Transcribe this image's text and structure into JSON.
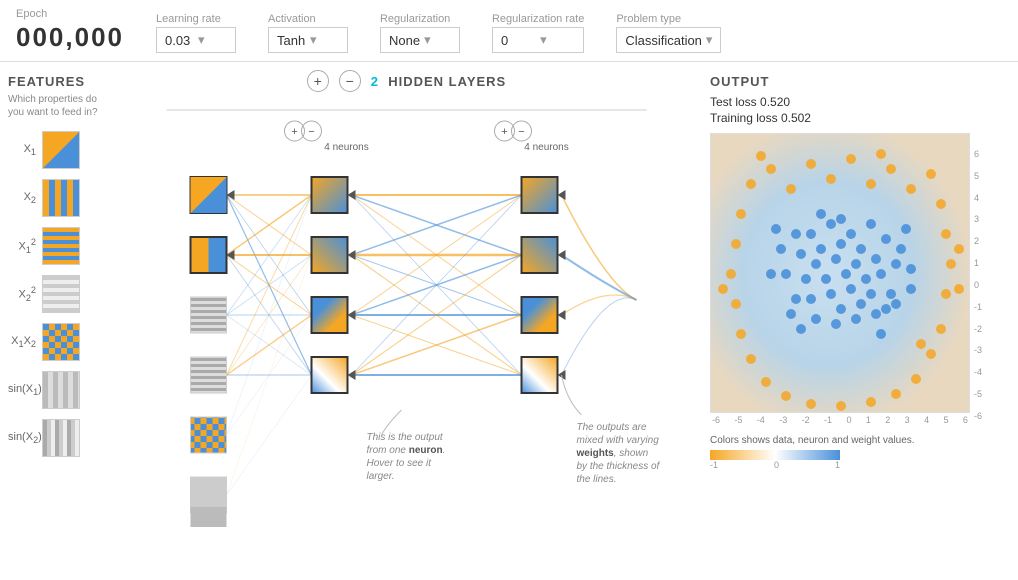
{
  "header": {
    "epoch_label": "Epoch",
    "epoch_value": "000,000",
    "learning_rate_label": "Learning rate",
    "learning_rate_value": "0.03",
    "activation_label": "Activation",
    "activation_value": "Tanh",
    "regularization_label": "Regularization",
    "regularization_value": "None",
    "regularization_rate_label": "Regularization rate",
    "regularization_rate_value": "0",
    "problem_type_label": "Problem type",
    "problem_type_value": "Classification"
  },
  "features": {
    "title": "FEATURES",
    "subtitle": "Which properties do you want to feed in?",
    "items": [
      {
        "label": "X₁",
        "style": "orange-blue"
      },
      {
        "label": "X₂",
        "style": "stripe-v"
      },
      {
        "label": "X₁²",
        "style": "stripe-h"
      },
      {
        "label": "X₂²",
        "style": "stripe-h2"
      },
      {
        "label": "X₁X₂",
        "style": "checker"
      },
      {
        "label": "sin(X₁)",
        "style": "sin1"
      },
      {
        "label": "sin(X₂)",
        "style": "sin2"
      }
    ]
  },
  "network": {
    "plus_label": "+",
    "minus_label": "−",
    "hidden_layers_count": "2",
    "hidden_layers_label": "HIDDEN LAYERS",
    "layer1_neurons_label": "4 neurons",
    "layer2_neurons_label": "4 neurons",
    "annotation1": "This is the output from one neuron. Hover to see it larger.",
    "annotation2": "The outputs are mixed with varying weights, shown by the thickness of the lines."
  },
  "output": {
    "title": "OUTPUT",
    "test_loss_label": "Test loss",
    "test_loss_value": "0.520",
    "training_loss_label": "Training loss",
    "training_loss_value": "0.502",
    "y_axis_values": [
      "6",
      "5",
      "4",
      "3",
      "2",
      "1",
      "0",
      "-1",
      "-2",
      "-3",
      "-4",
      "-5",
      "-6"
    ],
    "x_axis_values": [
      "-6",
      "-5",
      "-4",
      "-3",
      "-2",
      "-1",
      "0",
      "1",
      "2",
      "3",
      "4",
      "5",
      "6"
    ],
    "legend_text": "Colors shows data, neuron and weight values.",
    "legend_min": "-1",
    "legend_mid": "0",
    "legend_max": "1"
  }
}
